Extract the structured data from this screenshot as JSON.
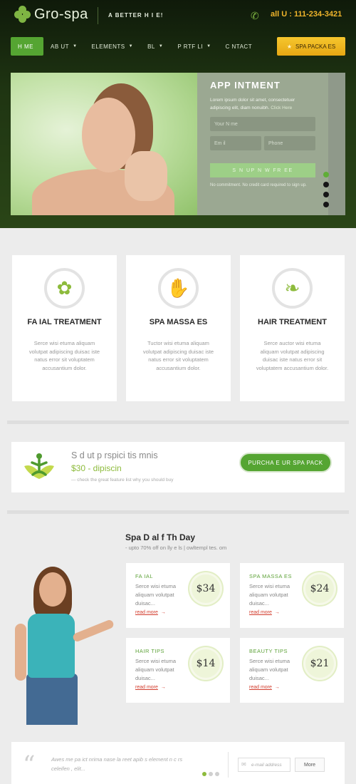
{
  "header": {
    "logo_text": "Gro-spa",
    "tagline": "A BETTER  H I E!",
    "phone_icon": "phone-icon",
    "phone_text": "all U : 111-234-3421"
  },
  "nav": {
    "items": [
      {
        "label": "H ME",
        "has_caret": false
      },
      {
        "label": "AB UT",
        "has_caret": true
      },
      {
        "label": "ELEMENTS",
        "has_caret": true
      },
      {
        "label": "BL",
        "has_caret": true
      },
      {
        "label": "P RTF LI",
        "has_caret": true
      },
      {
        "label": "C NTACT",
        "has_caret": false
      }
    ],
    "cta_label": "SPA PACKA  ES",
    "cta_icon": "star-icon"
  },
  "appointment": {
    "title": "APP   INTMENT",
    "desc": "Lorem ipsum dolor sit amet, consectetuer adipiscing elit, diam nonuibh.",
    "desc_link": "Click Here",
    "name_placeholder": "Your N  me",
    "email_placeholder": "Em  il",
    "phone_placeholder": "Phone",
    "button_label": "S  N UP N  W  FR EE",
    "footnote": "No commitment. No credit card required to sign up."
  },
  "slider": {
    "count": 4,
    "active_index": 0
  },
  "services": [
    {
      "icon": "flower-icon",
      "title": "FA   IAL TREATMENT",
      "text": "Serce wisi etuma aliquam volutpat adipiscing duisac iste natus error sit voluptatem accusantium dolor."
    },
    {
      "icon": "hand-icon",
      "title": "SPA MASSA   ES",
      "text": "Tuctor wisi etuma aliquam volutpat adipiscing duisac iste natus error sit voluptatem accusantium dolor."
    },
    {
      "icon": "leaf-icon",
      "title": "HAIR TREATMENT",
      "text": "Serce auctor wisi etuma aliquam volutpat adipiscing duisac iste natus error sit voluptatem accusantium dolor."
    }
  ],
  "package": {
    "icon": "yoga-icon",
    "title": "S  d ut p  rspici  tis    mnis",
    "price": "$30 -    dipiscin",
    "note": "— check the great feature list why you should buy",
    "button_label": "PURCHA   E    UR SPA PACK"
  },
  "deals": {
    "title": "Spa D  al    f Th    Day",
    "subtitle": "- upto 70% off on     lly   e  ls | owltempl   tes.  om",
    "items": [
      {
        "name": "FA   IAL",
        "text": "Serce wisi etuma aliquam volutpat duisac...",
        "link": "read more",
        "price": "$34"
      },
      {
        "name": "SPA MASSA   ES",
        "text": "Serce wisi etuma aliquam volutpat duisac...",
        "link": "read more",
        "price": "$24"
      },
      {
        "name": "HAIR TIPS",
        "text": "Serce wisi etuma aliquam volutpat duisac...",
        "link": "read more",
        "price": "$14"
      },
      {
        "name": "BEAUTY TIPS",
        "text": "Serce wisi etuma aliquam volutpat duisac...",
        "link": "read more",
        "price": "$21"
      }
    ]
  },
  "footer": {
    "quote": "Awes  me  pa  ict  nrima  nase   la  reet   apib  s element  n c  rs  celeifen  , elit...",
    "email_placeholder": "e-mail address",
    "more_label": "More",
    "dots_count": 3,
    "dots_active": 0
  },
  "colors": {
    "accent_green": "#55a532",
    "icon_green": "#8dbb3c",
    "cta_yellow": "#f6c72e",
    "link_red": "#d23c2d",
    "phone_yellow": "#f0b52b"
  }
}
